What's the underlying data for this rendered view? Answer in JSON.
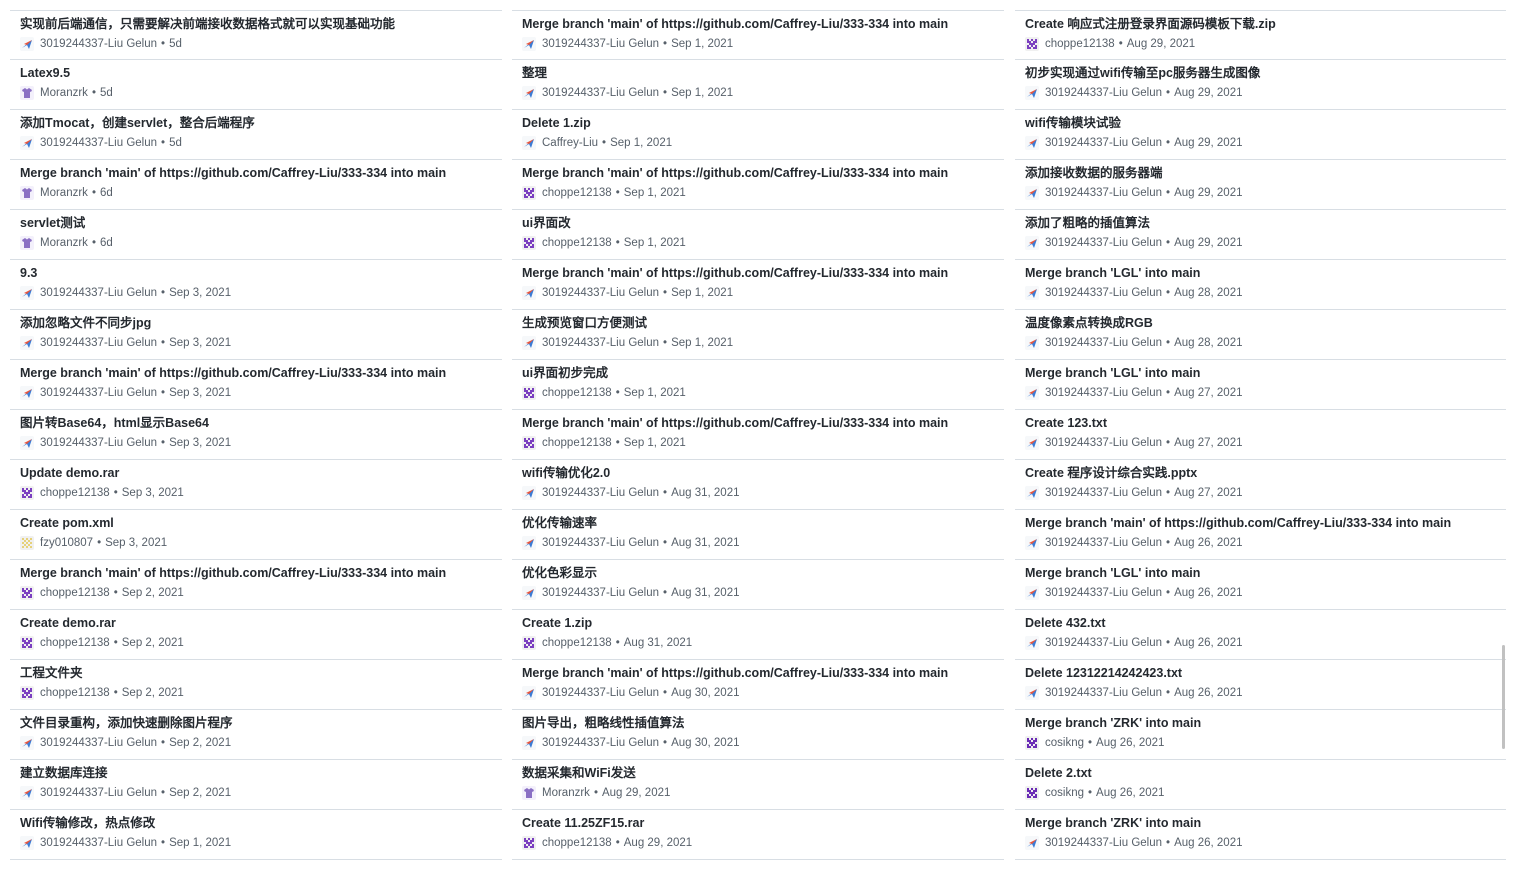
{
  "columns": [
    [
      {
        "msg": "实现前后端通信，只需要解决前端接收数据格式就可以实现基础功能",
        "author": "3019244337-Liu Gelun",
        "date": "5d",
        "avatar": "plane"
      },
      {
        "msg": "Latex9.5",
        "author": "Moranzrk",
        "date": "5d",
        "avatar": "shirt"
      },
      {
        "msg": "添加Tmocat，创建servlet，整合后端程序",
        "author": "3019244337-Liu Gelun",
        "date": "5d",
        "avatar": "plane"
      },
      {
        "msg": "Merge branch 'main' of https://github.com/Caffrey-Liu/333-334 into main",
        "author": "Moranzrk",
        "date": "6d",
        "avatar": "shirt"
      },
      {
        "msg": "servlet测试",
        "author": "Moranzrk",
        "date": "6d",
        "avatar": "shirt"
      },
      {
        "msg": "9.3",
        "author": "3019244337-Liu Gelun",
        "date": "Sep 3, 2021",
        "avatar": "plane"
      },
      {
        "msg": "添加忽略文件不同步jpg",
        "author": "3019244337-Liu Gelun",
        "date": "Sep 3, 2021",
        "avatar": "plane"
      },
      {
        "msg": "Merge branch 'main' of https://github.com/Caffrey-Liu/333-334 into main",
        "author": "3019244337-Liu Gelun",
        "date": "Sep 3, 2021",
        "avatar": "plane"
      },
      {
        "msg": "图片转Base64，html显示Base64",
        "author": "3019244337-Liu Gelun",
        "date": "Sep 3, 2021",
        "avatar": "plane"
      },
      {
        "msg": "Update demo.rar",
        "author": "choppe12138",
        "date": "Sep 3, 2021",
        "avatar": "pixel-purple"
      },
      {
        "msg": "Create pom.xml",
        "author": "fzy010807",
        "date": "Sep 3, 2021",
        "avatar": "pixel-yellow"
      },
      {
        "msg": "Merge branch 'main' of https://github.com/Caffrey-Liu/333-334 into main",
        "author": "choppe12138",
        "date": "Sep 2, 2021",
        "avatar": "pixel-purple"
      },
      {
        "msg": "Create demo.rar",
        "author": "choppe12138",
        "date": "Sep 2, 2021",
        "avatar": "pixel-purple"
      },
      {
        "msg": "工程文件夹",
        "author": "choppe12138",
        "date": "Sep 2, 2021",
        "avatar": "pixel-purple"
      },
      {
        "msg": "文件目录重构，添加快速删除图片程序",
        "author": "3019244337-Liu Gelun",
        "date": "Sep 2, 2021",
        "avatar": "plane"
      },
      {
        "msg": "建立数据库连接",
        "author": "3019244337-Liu Gelun",
        "date": "Sep 2, 2021",
        "avatar": "plane"
      },
      {
        "msg": "Wifi传输修改，热点修改",
        "author": "3019244337-Liu Gelun",
        "date": "Sep 1, 2021",
        "avatar": "plane"
      }
    ],
    [
      {
        "msg": "Merge branch 'main' of https://github.com/Caffrey-Liu/333-334 into main",
        "author": "3019244337-Liu Gelun",
        "date": "Sep 1, 2021",
        "avatar": "plane"
      },
      {
        "msg": "整理",
        "author": "3019244337-Liu Gelun",
        "date": "Sep 1, 2021",
        "avatar": "plane"
      },
      {
        "msg": "Delete 1.zip",
        "author": "Caffrey-Liu",
        "date": "Sep 1, 2021",
        "avatar": "plane"
      },
      {
        "msg": "Merge branch 'main' of https://github.com/Caffrey-Liu/333-334 into main",
        "author": "choppe12138",
        "date": "Sep 1, 2021",
        "avatar": "pixel-purple"
      },
      {
        "msg": "ui界面改",
        "author": "choppe12138",
        "date": "Sep 1, 2021",
        "avatar": "pixel-purple"
      },
      {
        "msg": "Merge branch 'main' of https://github.com/Caffrey-Liu/333-334 into main",
        "author": "3019244337-Liu Gelun",
        "date": "Sep 1, 2021",
        "avatar": "plane"
      },
      {
        "msg": "生成预览窗口方便测试",
        "author": "3019244337-Liu Gelun",
        "date": "Sep 1, 2021",
        "avatar": "plane"
      },
      {
        "msg": "ui界面初步完成",
        "author": "choppe12138",
        "date": "Sep 1, 2021",
        "avatar": "pixel-purple"
      },
      {
        "msg": "Merge branch 'main' of https://github.com/Caffrey-Liu/333-334 into main",
        "author": "choppe12138",
        "date": "Sep 1, 2021",
        "avatar": "pixel-purple"
      },
      {
        "msg": "wifi传输优化2.0",
        "author": "3019244337-Liu Gelun",
        "date": "Aug 31, 2021",
        "avatar": "plane"
      },
      {
        "msg": "优化传输速率",
        "author": "3019244337-Liu Gelun",
        "date": "Aug 31, 2021",
        "avatar": "plane"
      },
      {
        "msg": "优化色彩显示",
        "author": "3019244337-Liu Gelun",
        "date": "Aug 31, 2021",
        "avatar": "plane"
      },
      {
        "msg": "Create 1.zip",
        "author": "choppe12138",
        "date": "Aug 31, 2021",
        "avatar": "pixel-purple"
      },
      {
        "msg": "Merge branch 'main' of https://github.com/Caffrey-Liu/333-334 into main",
        "author": "3019244337-Liu Gelun",
        "date": "Aug 30, 2021",
        "avatar": "plane"
      },
      {
        "msg": "图片导出，粗略线性插值算法",
        "author": "3019244337-Liu Gelun",
        "date": "Aug 30, 2021",
        "avatar": "plane"
      },
      {
        "msg": "数据采集和WiFi发送",
        "author": "Moranzrk",
        "date": "Aug 29, 2021",
        "avatar": "shirt"
      },
      {
        "msg": "Create 11.25ZF15.rar",
        "author": "choppe12138",
        "date": "Aug 29, 2021",
        "avatar": "pixel-purple"
      }
    ],
    [
      {
        "msg": "Create 响应式注册登录界面源码模板下载.zip",
        "author": "choppe12138",
        "date": "Aug 29, 2021",
        "avatar": "pixel-purple"
      },
      {
        "msg": "初步实现通过wifi传输至pc服务器生成图像",
        "author": "3019244337-Liu Gelun",
        "date": "Aug 29, 2021",
        "avatar": "plane"
      },
      {
        "msg": "wifi传输模块试验",
        "author": "3019244337-Liu Gelun",
        "date": "Aug 29, 2021",
        "avatar": "plane"
      },
      {
        "msg": "添加接收数据的服务器端",
        "author": "3019244337-Liu Gelun",
        "date": "Aug 29, 2021",
        "avatar": "plane"
      },
      {
        "msg": "添加了粗略的插值算法",
        "author": "3019244337-Liu Gelun",
        "date": "Aug 29, 2021",
        "avatar": "plane"
      },
      {
        "msg": "Merge branch 'LGL' into main",
        "author": "3019244337-Liu Gelun",
        "date": "Aug 28, 2021",
        "avatar": "plane"
      },
      {
        "msg": "温度像素点转换成RGB",
        "author": "3019244337-Liu Gelun",
        "date": "Aug 28, 2021",
        "avatar": "plane"
      },
      {
        "msg": "Merge branch 'LGL' into main",
        "author": "3019244337-Liu Gelun",
        "date": "Aug 27, 2021",
        "avatar": "plane"
      },
      {
        "msg": "Create 123.txt",
        "author": "3019244337-Liu Gelun",
        "date": "Aug 27, 2021",
        "avatar": "plane"
      },
      {
        "msg": "Create 程序设计综合实践.pptx",
        "author": "3019244337-Liu Gelun",
        "date": "Aug 27, 2021",
        "avatar": "plane"
      },
      {
        "msg": "Merge branch 'main' of https://github.com/Caffrey-Liu/333-334 into main",
        "author": "3019244337-Liu Gelun",
        "date": "Aug 26, 2021",
        "avatar": "plane"
      },
      {
        "msg": "Merge branch 'LGL' into main",
        "author": "3019244337-Liu Gelun",
        "date": "Aug 26, 2021",
        "avatar": "plane"
      },
      {
        "msg": "Delete 432.txt",
        "author": "3019244337-Liu Gelun",
        "date": "Aug 26, 2021",
        "avatar": "plane"
      },
      {
        "msg": "Delete 12312214242423.txt",
        "author": "3019244337-Liu Gelun",
        "date": "Aug 26, 2021",
        "avatar": "plane"
      },
      {
        "msg": "Merge branch 'ZRK' into main",
        "author": "cosikng",
        "date": "Aug 26, 2021",
        "avatar": "pixel-violet"
      },
      {
        "msg": "Delete 2.txt",
        "author": "cosikng",
        "date": "Aug 26, 2021",
        "avatar": "pixel-violet"
      },
      {
        "msg": "Merge branch 'ZRK' into main",
        "author": "3019244337-Liu Gelun",
        "date": "Aug 26, 2021",
        "avatar": "plane"
      }
    ]
  ],
  "separator": "•",
  "avatar_colors": {
    "plane": "#3a7bd5",
    "shirt": "#8a6fc4",
    "pixel-purple": "#7b3fc0",
    "pixel-yellow": "#e6d17a",
    "pixel-violet": "#6a2bb5"
  }
}
